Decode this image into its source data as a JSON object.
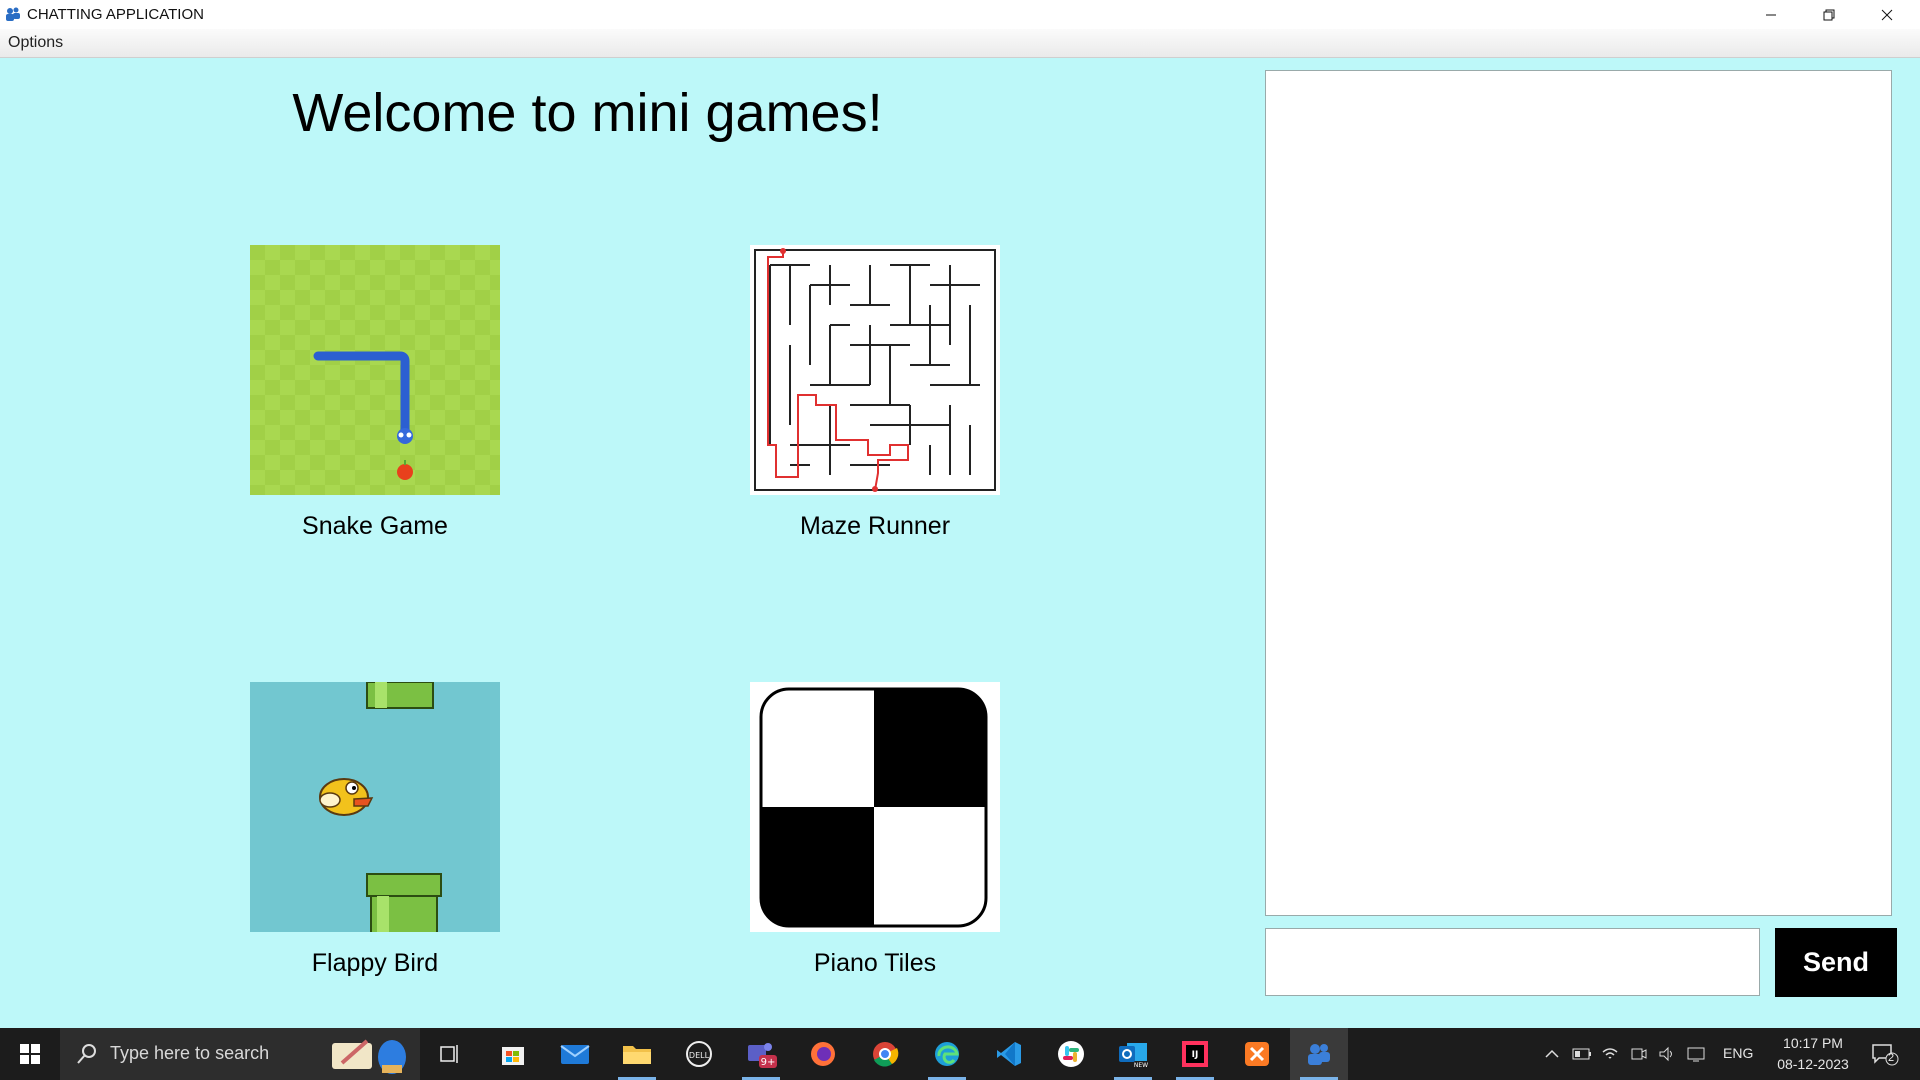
{
  "window": {
    "title": "CHATTING APPLICATION"
  },
  "menu": {
    "items": [
      "Options"
    ]
  },
  "main": {
    "heading": "Welcome to mini games!",
    "games": [
      {
        "label": "Snake Game",
        "icon": "snake-game-icon"
      },
      {
        "label": "Maze Runner",
        "icon": "maze-icon"
      },
      {
        "label": "Flappy Bird",
        "icon": "flappy-bird-icon"
      },
      {
        "label": "Piano Tiles",
        "icon": "piano-tiles-icon"
      }
    ]
  },
  "chat": {
    "log_text": "",
    "input_value": "",
    "send_label": "Send"
  },
  "taskbar": {
    "search_placeholder": "Type here to search",
    "teams_badge": "9+",
    "outlook_badge": "NEW",
    "language": "ENG",
    "time": "10:17 PM",
    "date": "08-12-2023",
    "notification_count": "2"
  },
  "colors": {
    "background": "#bdf8f9",
    "snake_green": "#a6d94a",
    "flappy_sky": "#72c7d0",
    "taskbar": "#1c1c1c"
  }
}
